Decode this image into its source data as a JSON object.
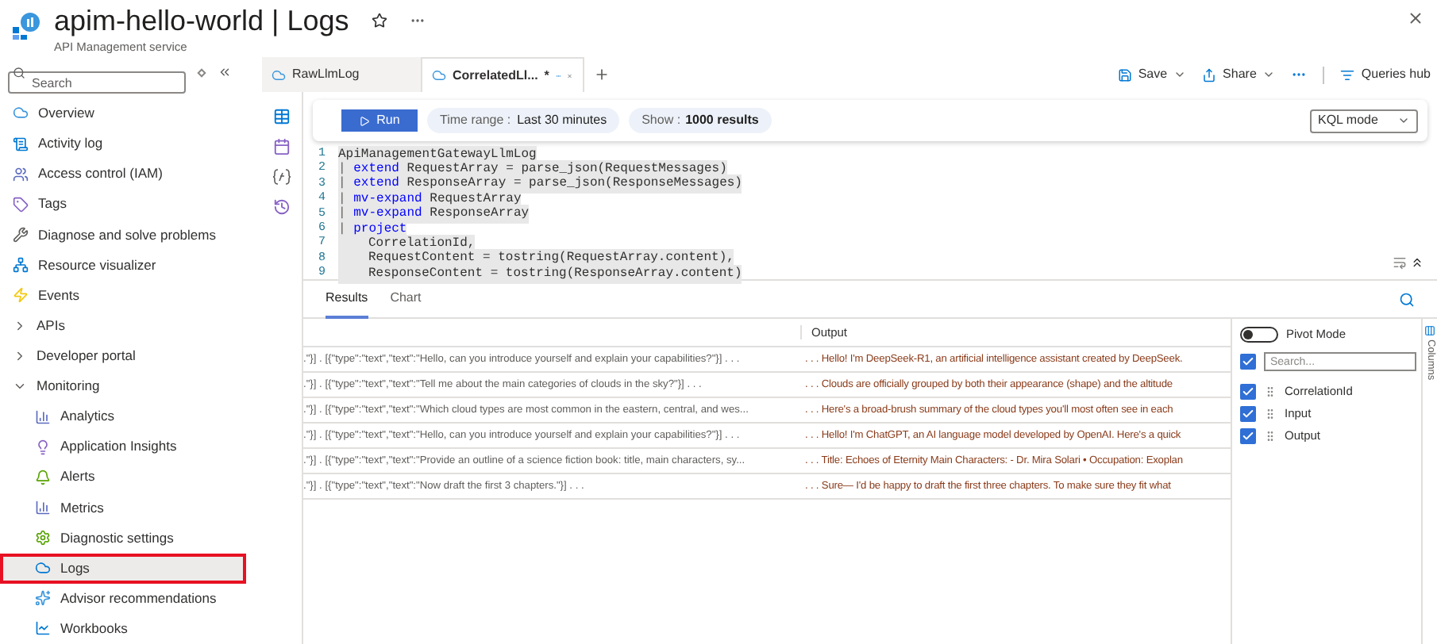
{
  "header": {
    "title": "apim-hello-world | Logs",
    "subtitle": "API Management service"
  },
  "sidebar": {
    "search_placeholder": "Search",
    "items": [
      {
        "label": "Overview",
        "selected": false
      },
      {
        "label": "Activity log",
        "selected": false
      },
      {
        "label": "Access control (IAM)",
        "selected": false
      },
      {
        "label": "Tags",
        "selected": false
      },
      {
        "label": "Diagnose and solve problems",
        "selected": false
      },
      {
        "label": "Resource visualizer",
        "selected": false
      },
      {
        "label": "Events",
        "selected": false
      },
      {
        "label": "APIs",
        "selected": false,
        "expanded": false
      },
      {
        "label": "Developer portal",
        "selected": false,
        "expanded": false
      },
      {
        "label": "Monitoring",
        "selected": false,
        "expanded": true,
        "children": [
          {
            "label": "Analytics",
            "selected": false
          },
          {
            "label": "Application Insights",
            "selected": false
          },
          {
            "label": "Alerts",
            "selected": false
          },
          {
            "label": "Metrics",
            "selected": false
          },
          {
            "label": "Diagnostic settings",
            "selected": false
          },
          {
            "label": "Logs",
            "selected": true
          },
          {
            "label": "Advisor recommendations",
            "selected": false
          },
          {
            "label": "Workbooks",
            "selected": false
          }
        ]
      }
    ]
  },
  "tabs": [
    {
      "label": "RawLlmLog",
      "selected": false
    },
    {
      "label": "CorrelatedLl...",
      "selected": true,
      "unsaved_mark": "*"
    }
  ],
  "actions": [
    {
      "label": "Save"
    },
    {
      "label": "Share"
    }
  ],
  "queries_hub": "Queries hub",
  "query_bar": {
    "run": "Run",
    "time_range_label": "Time range :",
    "time_range": "Last 30 minutes",
    "show_label": "Show :",
    "show": "1000 results",
    "mode": "KQL mode"
  },
  "editor": {
    "lines": [
      {
        "number": "1",
        "kind": "plain",
        "text": "ApiManagementGatewayLlmLog"
      },
      {
        "number": "2",
        "kind": "pipe",
        "pipe": "|",
        "keyword": "extend",
        "text": "RequestArray = parse_json(RequestMessages)"
      },
      {
        "number": "3",
        "kind": "pipe",
        "pipe": "|",
        "keyword": "extend",
        "text": "ResponseArray = parse_json(ResponseMessages)"
      },
      {
        "number": "4",
        "kind": "pipe",
        "pipe": "|",
        "keyword": "mv-expand",
        "text": "RequestArray"
      },
      {
        "number": "5",
        "kind": "pipe",
        "pipe": "|",
        "keyword": "mv-expand",
        "text": "ResponseArray"
      },
      {
        "number": "6",
        "kind": "pipe",
        "pipe": "|",
        "keyword": "project"
      },
      {
        "number": "7",
        "kind": "indented",
        "text": "CorrelationId,"
      },
      {
        "number": "8",
        "kind": "indented",
        "text": "RequestContent = tostring(RequestArray.content),"
      },
      {
        "number": "9",
        "kind": "indented",
        "text": "ResponseContent = tostring(ResponseArray.content)"
      }
    ]
  },
  "result_tabs": [
    {
      "label": "Results",
      "selected": true
    },
    {
      "label": "Chart",
      "selected": false
    }
  ],
  "table": {
    "columns": [
      "Output"
    ],
    "rows": [
      {
        "column_1": ".\"}] . [{\"type\":\"text\",\"text\":\"Hello, can you introduce yourself and explain your capabilities?\"}] . . .",
        "output": ". . . Hello! I'm DeepSeek-R1, an artificial intelligence assistant created by DeepSeek."
      },
      {
        "column_1": ".\"}] . [{\"type\":\"text\",\"text\":\"Tell me about the main categories of clouds in the sky?\"}] . . .",
        "output": ". . . Clouds are officially grouped by both their appearance (shape) and the altitude"
      },
      {
        "column_1": ".\"}] . [{\"type\":\"text\",\"text\":\"Which cloud types are most common in the eastern, central, and wes...",
        "output": ". . . Here's a broad-brush summary of the cloud types you'll most often see in each"
      },
      {
        "column_1": ".\"}] . [{\"type\":\"text\",\"text\":\"Hello, can you introduce yourself and explain your capabilities?\"}] . . .",
        "output": ". . . Hello! I'm ChatGPT, an AI language model developed by OpenAI. Here's a quick"
      },
      {
        "column_1": ".\"}] . [{\"type\":\"text\",\"text\":\"Provide an outline of a science fiction book: title, main characters, sy...",
        "output": ". . . Title: Echoes of Eternity Main Characters: - Dr. Mira Solari • Occupation: Exoplan"
      },
      {
        "column_1": ".\"}] . [{\"type\":\"text\",\"text\":\"Now draft the first 3 chapters.\"}] . . .",
        "output": ". . . Sure— I'd be happy to draft the first three chapters. To make sure they fit what"
      }
    ]
  },
  "column_panel": {
    "pivot_mode": {
      "label": "Pivot Mode",
      "on": false
    },
    "select_all": {
      "checked": true
    },
    "search_placeholder": "Search...",
    "columns": [
      {
        "label": "CorrelationId",
        "checked": true
      },
      {
        "label": "Input",
        "checked": true
      },
      {
        "label": "Output",
        "checked": true
      }
    ],
    "side_tab": "Columns"
  }
}
